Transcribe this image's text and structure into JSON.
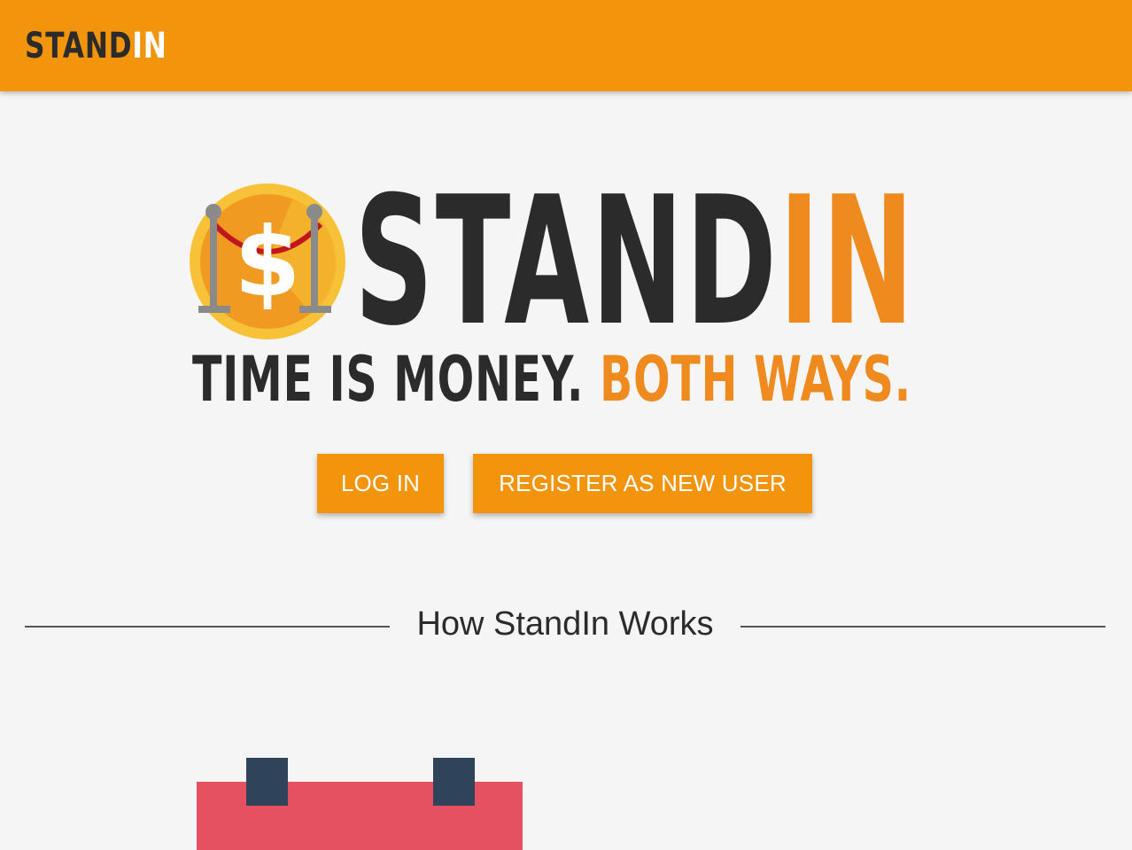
{
  "navbar": {
    "brand_main": "STAND",
    "brand_highlight": "IN",
    "background": "#f2950d"
  },
  "hero": {
    "logo_icon": "dollar-coin-velvet-rope-icon",
    "wordmark_main": "STAND",
    "wordmark_highlight": "IN",
    "tagline_main": "TIME IS MONEY.",
    "tagline_highlight": "BOTH WAYS.",
    "accent_color": "#ee8a1e",
    "text_color": "#2b2b2b"
  },
  "actions": {
    "login_label": "LOG IN",
    "register_label": "REGISTER AS NEW USER"
  },
  "how_it_works": {
    "title": "How StandIn Works",
    "illustration_icon": "calendar-icon"
  }
}
